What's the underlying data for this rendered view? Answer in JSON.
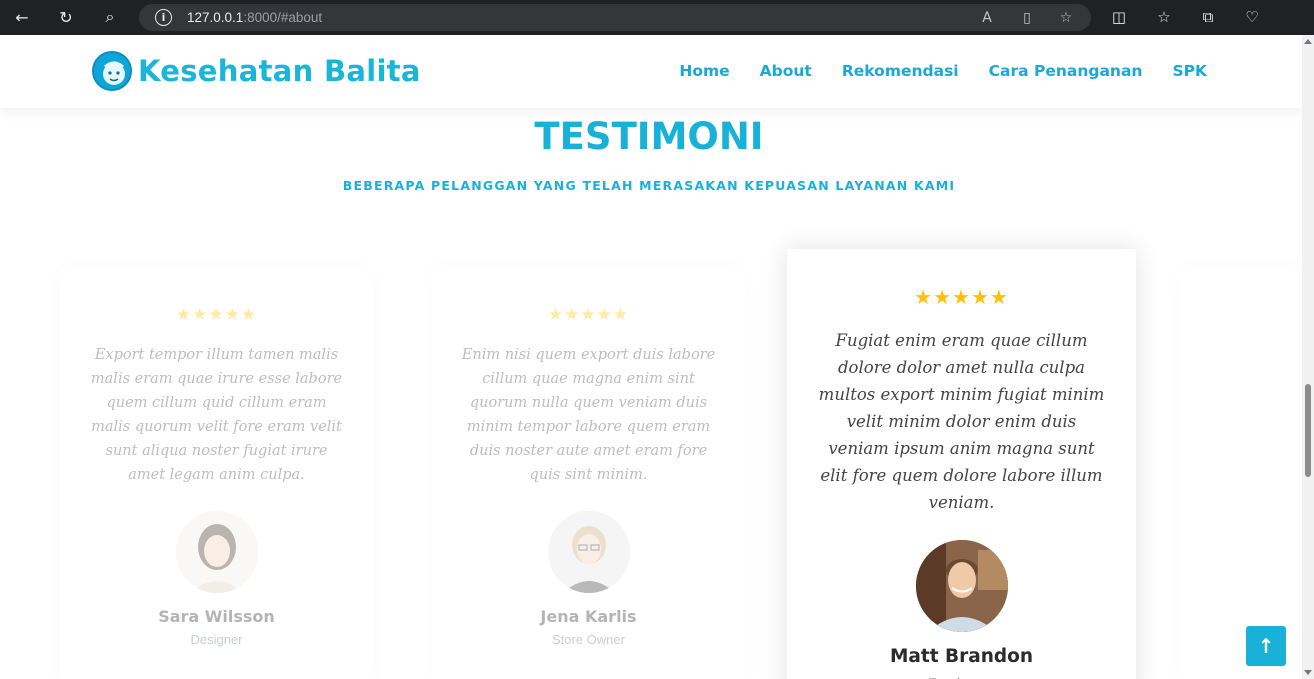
{
  "browser": {
    "url_host": "127.0.0.1",
    "url_rest": ":8000/#about",
    "info_icon": "i"
  },
  "header": {
    "logo_text": "Kesehatan Balita",
    "nav": [
      "Home",
      "About",
      "Rekomendasi",
      "Cara Penanganan",
      "SPK"
    ]
  },
  "section": {
    "title": "TESTIMONI",
    "subtitle": "BEBERAPA PELANGGAN YANG TELAH MERASAKAN KEPUASAN LAYANAN KAMI"
  },
  "testimonials": [
    {
      "stars": "★★★★★",
      "rating": 5,
      "quote": "Export tempor illum tamen malis malis eram quae irure esse labore quem cillum quid cillum eram malis quorum velit fore eram velit sunt aliqua noster fugiat irure amet legam anim culpa.",
      "name": "Sara Wilsson",
      "role": "Designer"
    },
    {
      "stars": "★★★★★",
      "rating": 5,
      "quote": "Enim nisi quem export duis labore cillum quae magna enim sint quorum nulla quem veniam duis minim tempor labore quem eram duis noster aute amet eram fore quis sint minim.",
      "name": "Jena Karlis",
      "role": "Store Owner"
    },
    {
      "stars": "★★★★★",
      "rating": 5,
      "quote": "Fugiat enim eram quae cillum dolore dolor amet nulla culpa multos export minim fugiat minim velit minim dolor enim duis veniam ipsum anim magna sunt elit fore quem dolore labore illum veniam.",
      "name": "Matt Brandon",
      "role": "Freelancer"
    }
  ],
  "back_to_top": "↑",
  "colors": {
    "accent": "#19b1d8",
    "star": "#ffc107"
  }
}
